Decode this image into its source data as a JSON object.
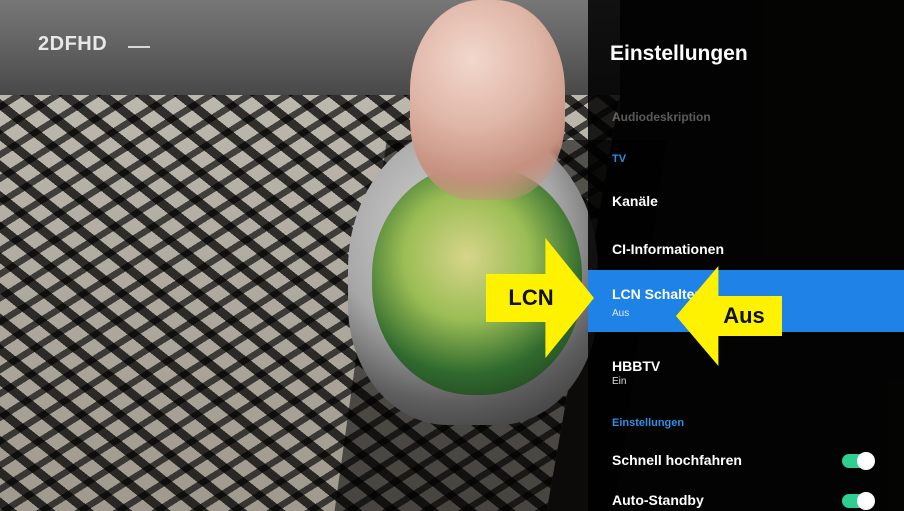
{
  "channel": {
    "logo_text": "2DFHD"
  },
  "settings": {
    "title": "Einstellungen",
    "items": [
      {
        "label": "Audiodeskription",
        "style": "muted"
      },
      {
        "label": "TV",
        "style": "section"
      },
      {
        "label": "Kanäle",
        "style": "normal"
      },
      {
        "label": "CI-Informationen",
        "style": "normal"
      },
      {
        "label": "LCN Schalter",
        "value": "Aus",
        "style": "highlight"
      },
      {
        "label": "HBBTV",
        "value": "Ein",
        "style": "normal"
      },
      {
        "label": "Einstellungen",
        "style": "section"
      },
      {
        "label": "Schnell hochfahren",
        "style": "toggle",
        "toggle_state": "on"
      },
      {
        "label": "Auto-Standby",
        "style": "toggle",
        "toggle_state": "on"
      }
    ]
  },
  "callouts": {
    "left_arrow_text": "LCN",
    "right_arrow_text": "Aus",
    "color": "#fff200"
  },
  "colors": {
    "panel_bg": "#000000",
    "highlight": "#1f82e6",
    "section": "#2f8ee5",
    "toggle_on": "#2fcf92"
  }
}
